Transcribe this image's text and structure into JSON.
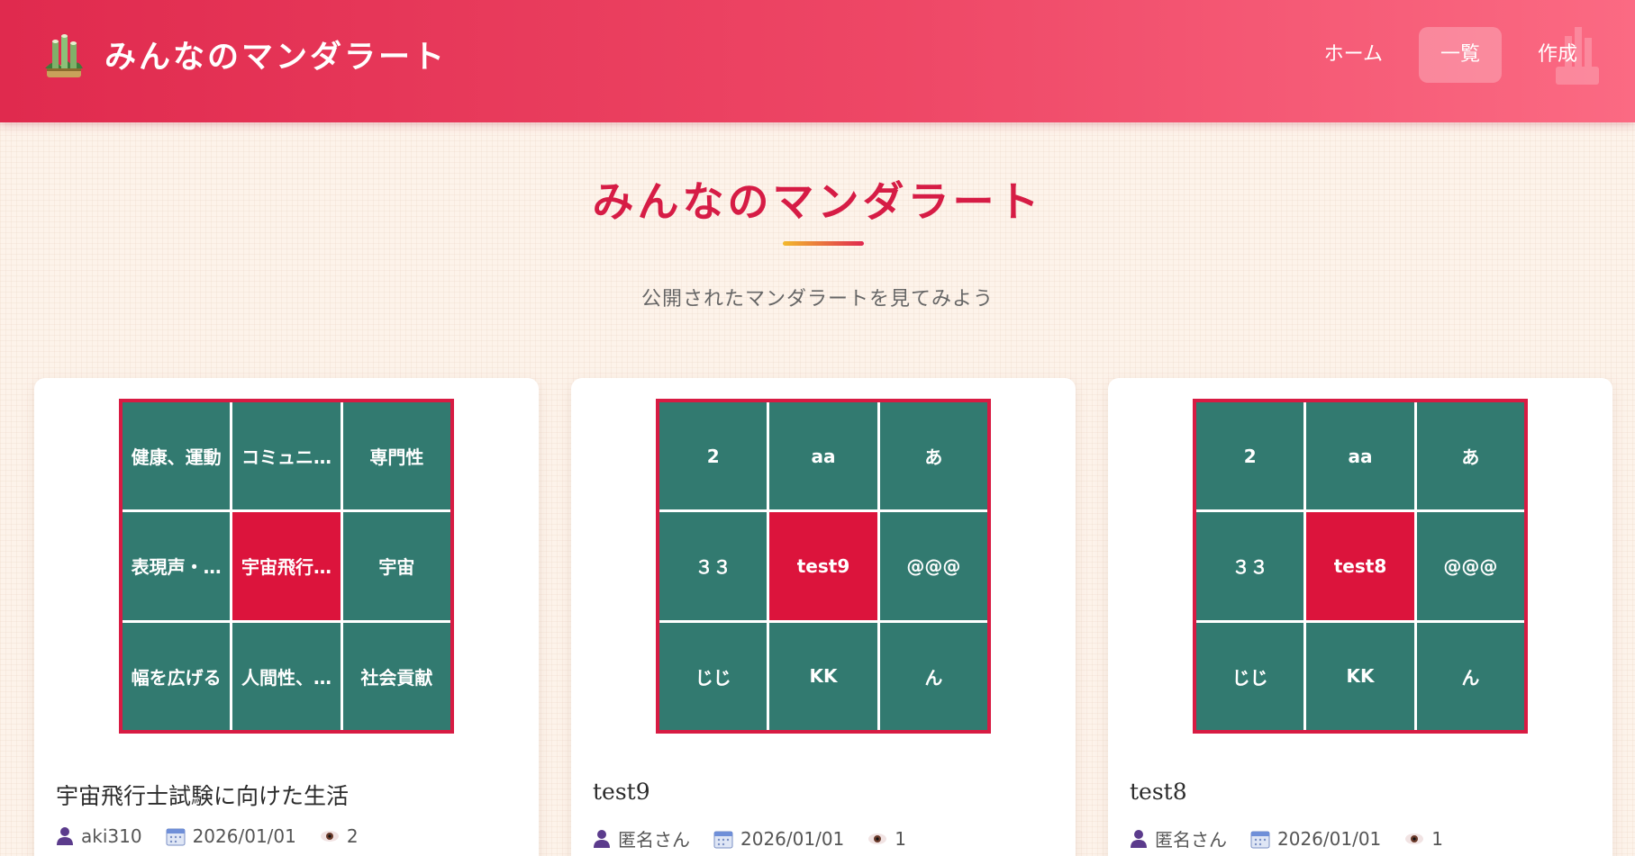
{
  "app": {
    "title": "みんなのマンダラート",
    "logo_icon": "kadomatsu-icon"
  },
  "nav": {
    "items": [
      {
        "label": "ホーム"
      },
      {
        "label": "一覧"
      },
      {
        "label": "作成"
      }
    ],
    "active": "一覧"
  },
  "page": {
    "title": "みんなのマンダラート",
    "subtitle": "公開されたマンダラートを見てみよう"
  },
  "cards": [
    {
      "cells": [
        "健康、運動",
        "コミュニ…",
        "専門性",
        "表現声・…",
        "宇宙飛行…",
        "宇宙",
        "幅を広げる",
        "人間性、…",
        "社会貢献"
      ],
      "title": "宇宙飛行士試験に向けた生活",
      "author": "aki310",
      "date": "2026/01/01",
      "views": "2"
    },
    {
      "cells": [
        "2",
        "aa",
        "あ",
        "３３",
        "test9",
        "@@@",
        "じじ",
        "KK",
        "ん"
      ],
      "title": "test9",
      "author": "匿名さん",
      "date": "2026/01/01",
      "views": "1"
    },
    {
      "cells": [
        "2",
        "aa",
        "あ",
        "３３",
        "test8",
        "@@@",
        "じじ",
        "KK",
        "ん"
      ],
      "title": "test8",
      "author": "匿名さん",
      "date": "2026/01/01",
      "views": "1"
    }
  ],
  "colors": {
    "header_start": "#e02a4e",
    "header_end": "#fb6a83",
    "accent": "#d61c45",
    "cell": "#327a70",
    "center_cell": "#dc143c"
  }
}
